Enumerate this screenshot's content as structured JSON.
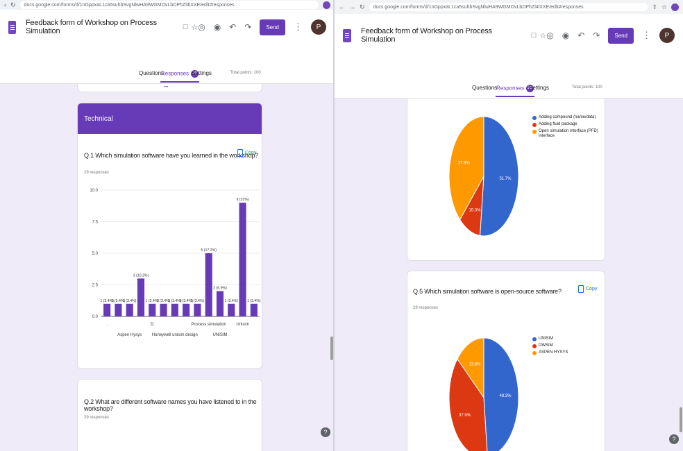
{
  "left": {
    "url": "docs.google.com/forms/d/1nGppxaL1ca5suhbSvgNlwHA9WGMOvLbDPhZl4lXXE/edit#responses",
    "form_title": "Feedback form of Workshop on Process Simulation",
    "send_label": "Send",
    "avatar_letter": "P",
    "tabs": {
      "questions": "Questions",
      "responses": "Responses",
      "responses_count": "29",
      "settings": "Settings"
    },
    "total_points": "Total points: 100",
    "section_title": "Technical",
    "q1": {
      "title": "Q.1 Which simulation software have you learned in the workshop?",
      "responses": "29 responses",
      "copy_label": "Copy"
    },
    "q2": {
      "title": "Q.2 What are different software names you have listened to in the workshop?",
      "responses": "29 responses"
    }
  },
  "right": {
    "url": "docs.google.com/forms/d/1nGppxaL1ca5suhbSvgNlwHA9WGMOvLbDPhZl4lXXE/edit#responses",
    "form_title": "Feedback form of Workshop on Process Simulation",
    "send_label": "Send",
    "avatar_letter": "P",
    "tabs": {
      "questions": "Questions",
      "responses": "Responses",
      "responses_count": "29",
      "settings": "Settings"
    },
    "total_points": "Total points: 100",
    "q4_legend": [
      "Adding compound (name/data)",
      "Adding fluid package",
      "Open simulation interface (PFD) interface"
    ],
    "q5": {
      "title": "Q.5 Which simulation software is open-source software?",
      "responses": "29 responses",
      "copy_label": "Copy",
      "legend": [
        "UNISIM",
        "DWSIM",
        "ASPEN HYSYS"
      ]
    }
  },
  "colors": {
    "purple": "#673ab7",
    "blue": "#3366cc",
    "red": "#dc3912",
    "orange": "#ff9900",
    "bar": "#673ab7"
  },
  "chart_data": [
    {
      "type": "bar",
      "ylim": [
        0,
        10
      ],
      "yticks": [
        "0.0",
        "2.5",
        "5.0",
        "7.5",
        "10.0"
      ],
      "values": [
        1,
        1,
        1,
        3,
        1,
        1,
        1,
        1,
        1,
        5,
        2,
        1,
        9,
        1
      ],
      "value_labels": [
        "1 (3.4%)",
        "1 (3.4%)",
        "1 (3.4%)",
        "3 (10.3%)",
        "1 (3.4%)",
        "1 (3.4%)",
        "1 (3.4%)",
        "1 (3.4%)",
        "1 (3.4%)",
        "5 (17.2%)",
        "2 (6.9%)",
        "1 (3.4%)",
        "9 (31%)",
        "1 (3.4%)"
      ],
      "tick_labels": [
        {
          "index": 0,
          "row": 1,
          "text": "."
        },
        {
          "index": 2,
          "row": 2,
          "text": "Aspen Hysys"
        },
        {
          "index": 4,
          "row": 1,
          "text": "D"
        },
        {
          "index": 6,
          "row": 2,
          "text": "Honeywell unisim design"
        },
        {
          "index": 9,
          "row": 1,
          "text": "Process simulation"
        },
        {
          "index": 10,
          "row": 2,
          "text": "UNISIM"
        },
        {
          "index": 12,
          "row": 1,
          "text": "Unisim"
        }
      ]
    },
    {
      "type": "pie",
      "slices": [
        {
          "label": "Adding compound (name/data)",
          "value": 51.7,
          "color": "#3366cc"
        },
        {
          "label": "Adding fluid package",
          "value": 10.3,
          "color": "#dc3912"
        },
        {
          "label": "Open simulation interface (PFD) interface",
          "value": 37.9,
          "color": "#ff9900"
        }
      ],
      "slice_labels": [
        "51.7%",
        "10.3%",
        "37.9%"
      ]
    },
    {
      "type": "pie",
      "slices": [
        {
          "label": "UNISIM",
          "value": 48.3,
          "color": "#3366cc"
        },
        {
          "label": "DWSIM",
          "value": 37.9,
          "color": "#dc3912"
        },
        {
          "label": "ASPEN HYSYS",
          "value": 13.8,
          "color": "#ff9900"
        }
      ],
      "slice_labels": [
        "48.3%",
        "37.9%",
        "13.8%"
      ]
    }
  ]
}
